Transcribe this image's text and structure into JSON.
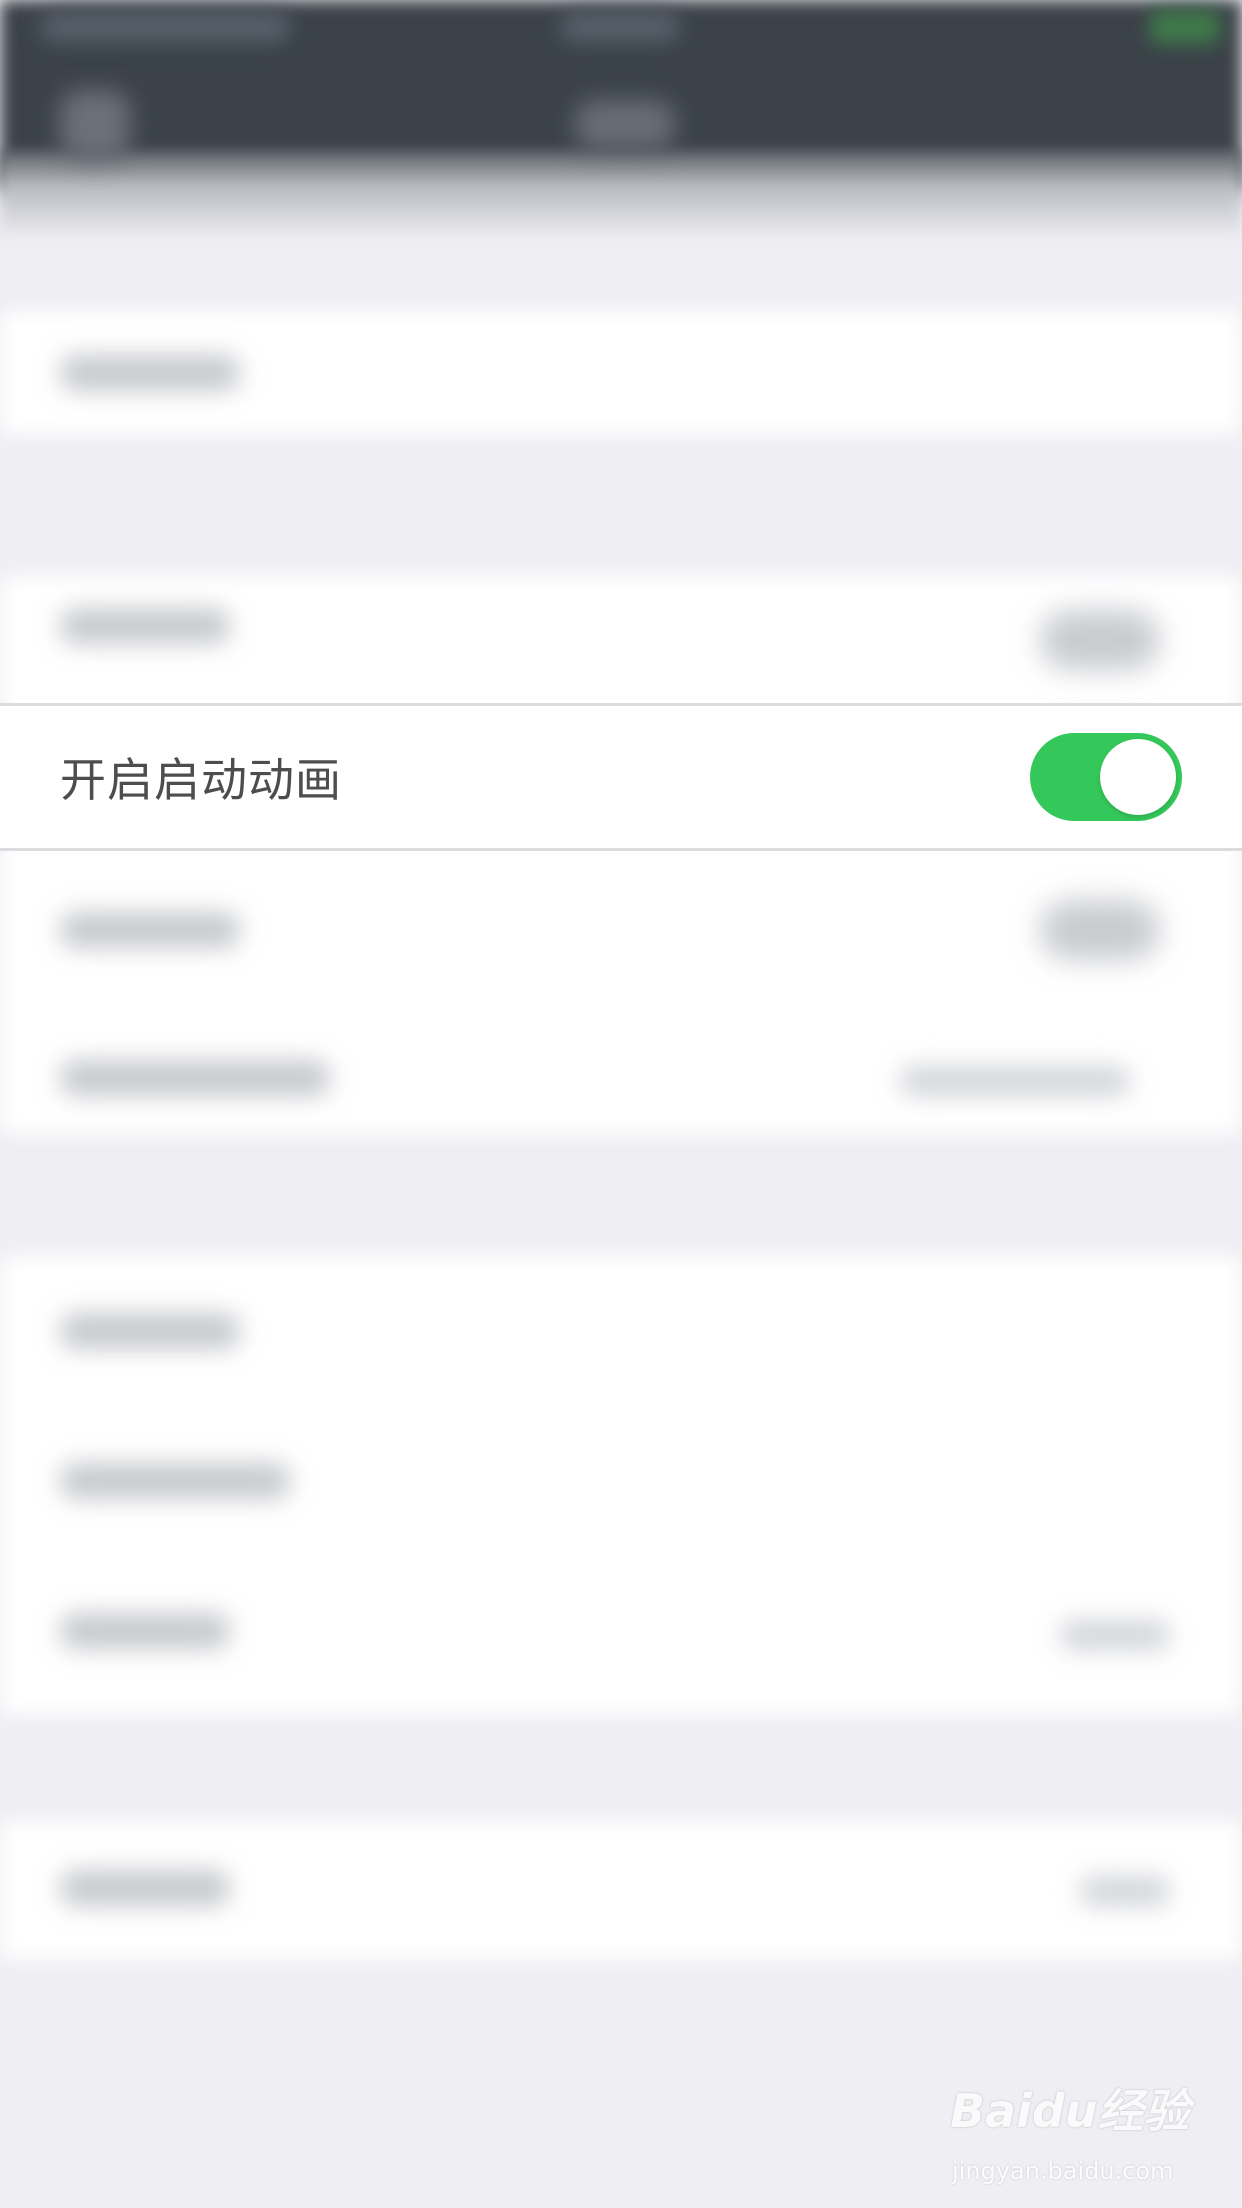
{
  "focused_setting": {
    "label": "开启启动动画",
    "toggle_on": true,
    "toggle_color": "#34c759"
  },
  "watermark": {
    "logo_text": "Baidu经验",
    "url": "jingyan.baidu.com"
  },
  "colors": {
    "background": "#eeeef3",
    "navbar": "#3b4249",
    "row": "#ffffff"
  }
}
